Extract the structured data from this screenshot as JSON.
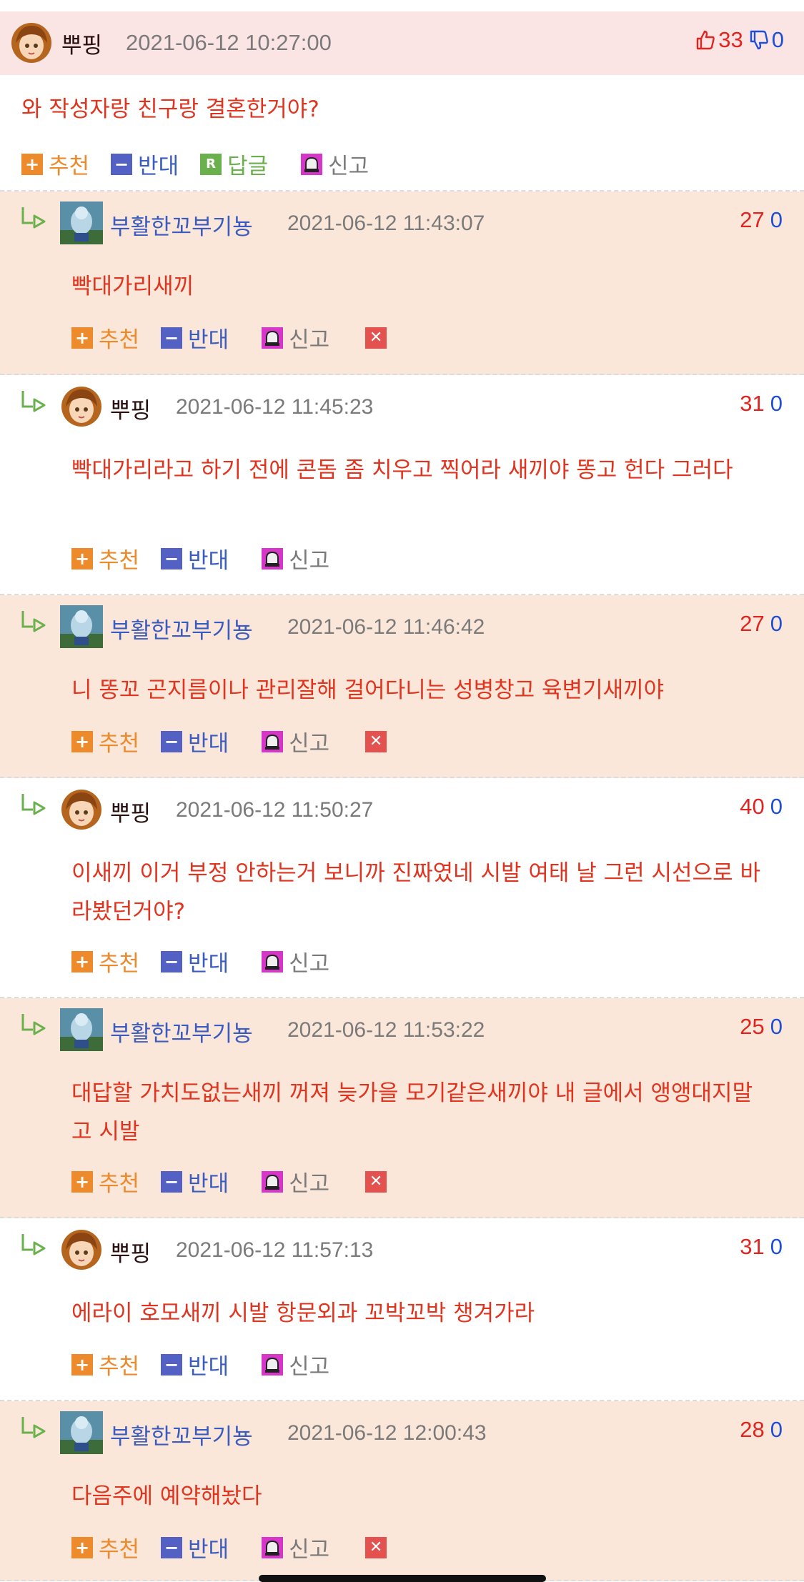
{
  "main_comment": {
    "nickname": "뿌핑",
    "date": "2021-06-12 10:27:00",
    "up_count": "33",
    "down_count": "0",
    "text": "와 작성자랑 친구랑 결혼한거야?"
  },
  "actions": {
    "recommend": "추천",
    "oppose": "반대",
    "reply": "답글",
    "report": "신고",
    "reply_badge": "R"
  },
  "replies": [
    {
      "nickname": "부활한꼬부기뇽",
      "date": "2021-06-12 11:43:07",
      "up": "27",
      "down": "0",
      "text": "빡대가리새끼"
    },
    {
      "nickname": "뿌핑",
      "date": "2021-06-12 11:45:23",
      "up": "31",
      "down": "0",
      "text": "빡대가리라고 하기 전에 콘돔 좀 치우고 찍어라 새끼야 똥고 헌다 그러다"
    },
    {
      "nickname": "부활한꼬부기뇽",
      "date": "2021-06-12 11:46:42",
      "up": "27",
      "down": "0",
      "text": "니 똥꼬 곤지름이나 관리잘해 걸어다니는 성병창고 육변기새끼야"
    },
    {
      "nickname": "뿌핑",
      "date": "2021-06-12 11:50:27",
      "up": "40",
      "down": "0",
      "text": "이새끼 이거 부정 안하는거 보니까 진짜였네 시발 여태 날 그런 시선으로 바라봤던거야?"
    },
    {
      "nickname": "부활한꼬부기뇽",
      "date": "2021-06-12 11:53:22",
      "up": "25",
      "down": "0",
      "text": "대답할 가치도없는새끼 꺼져 늦가을 모기같은새끼야 내 글에서 앵앵대지말고 시발"
    },
    {
      "nickname": "뿌핑",
      "date": "2021-06-12 11:57:13",
      "up": "31",
      "down": "0",
      "text": "에라이 호모새끼 시발 항문외과 꼬박꼬박 챙겨가라"
    },
    {
      "nickname": "부활한꼬부기뇽",
      "date": "2021-06-12 12:00:43",
      "up": "28",
      "down": "0",
      "text": "다음주에 예약해놨다"
    }
  ],
  "colors": {
    "accent_red": "#e0341f",
    "nick_blue": "#3a5bbf",
    "recommend_orange": "#ed8a2c",
    "oppose_blue": "#5461c4",
    "reply_green": "#6ab04c",
    "delete_red": "#e4524f",
    "row_orange_bg": "#fbe7d9",
    "header_pink_bg": "#fbe4e4"
  }
}
